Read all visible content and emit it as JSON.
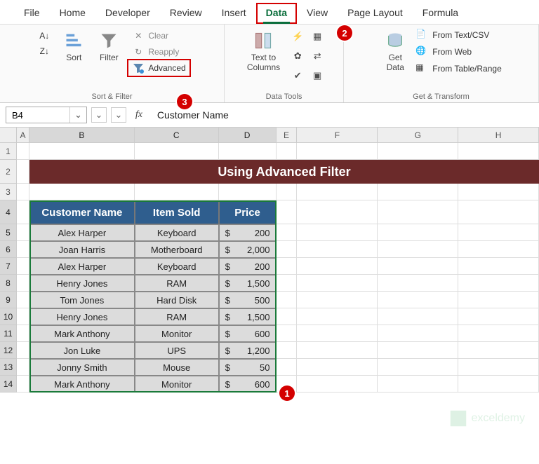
{
  "tabs": [
    "File",
    "Home",
    "Developer",
    "Review",
    "Insert",
    "Data",
    "View",
    "Page Layout",
    "Formula"
  ],
  "active_tab": "Data",
  "ribbon": {
    "sort_filter": {
      "sort": "Sort",
      "filter": "Filter",
      "clear": "Clear",
      "reapply": "Reapply",
      "advanced": "Advanced",
      "group": "Sort & Filter"
    },
    "text_to_columns": "Text to\nColumns",
    "data_tools_group": "Data Tools",
    "get_data": "Get\nData",
    "from_text": "From Text/CSV",
    "from_web": "From Web",
    "from_table": "From Table/Range",
    "get_transform_group": "Get & Transform"
  },
  "namebox": "B4",
  "formula": "Customer Name",
  "columns": [
    "A",
    "B",
    "C",
    "D",
    "E",
    "F",
    "G",
    "H"
  ],
  "rows": [
    "1",
    "2",
    "3",
    "4",
    "5",
    "6",
    "7",
    "8",
    "9",
    "10",
    "11",
    "12",
    "13",
    "14"
  ],
  "sheet_title": "Using Advanced Filter",
  "headers": [
    "Customer Name",
    "Item Sold",
    "Price"
  ],
  "data": [
    {
      "name": "Alex Harper",
      "item": "Keyboard",
      "price": "200"
    },
    {
      "name": "Joan Harris",
      "item": "Motherboard",
      "price": "2,000"
    },
    {
      "name": "Alex Harper",
      "item": "Keyboard",
      "price": "200"
    },
    {
      "name": "Henry Jones",
      "item": "RAM",
      "price": "1,500"
    },
    {
      "name": "Tom Jones",
      "item": "Hard Disk",
      "price": "500"
    },
    {
      "name": "Henry Jones",
      "item": "RAM",
      "price": "1,500"
    },
    {
      "name": "Mark Anthony",
      "item": "Monitor",
      "price": "600"
    },
    {
      "name": "Jon Luke",
      "item": "UPS",
      "price": "1,200"
    },
    {
      "name": "Jonny Smith",
      "item": "Mouse",
      "price": "50"
    },
    {
      "name": "Mark Anthony",
      "item": "Monitor",
      "price": "600"
    }
  ],
  "currency": "$",
  "annotations": {
    "1": "1",
    "2": "2",
    "3": "3"
  },
  "watermark": "exceldemy"
}
